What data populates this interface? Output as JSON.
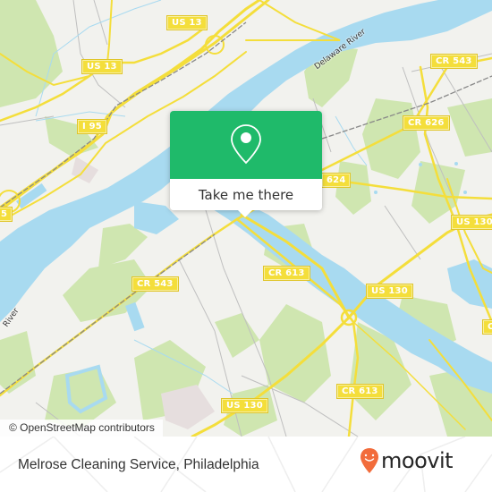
{
  "map": {
    "attribution": "© OpenStreetMap contributors",
    "colors": {
      "water": "#a8daf0",
      "land": "#f2f2ee",
      "park": "#cfe6b0",
      "road_major": "#f4de3b",
      "rail": "#888888",
      "accent_green": "#1fba6a"
    },
    "road_labels": [
      {
        "id": "us13-a",
        "text": "US 13"
      },
      {
        "id": "us13-b",
        "text": "US 13"
      },
      {
        "id": "i95",
        "text": "I 95"
      },
      {
        "id": "cr543-a",
        "text": "CR 543"
      },
      {
        "id": "cr626",
        "text": "CR 626"
      },
      {
        "id": "cr624",
        "text": "624"
      },
      {
        "id": "us130-a",
        "text": "US 130"
      },
      {
        "id": "us130-b",
        "text": "US 130"
      },
      {
        "id": "us130-c",
        "text": "US 130"
      },
      {
        "id": "cr543-b",
        "text": "CR 543"
      },
      {
        "id": "cr613-a",
        "text": "CR 613"
      },
      {
        "id": "cr613-b",
        "text": "CR 613"
      },
      {
        "id": "edge-left",
        "text": "5"
      },
      {
        "id": "edge-right",
        "text": "C"
      }
    ],
    "water_labels": [
      {
        "id": "delaware-river-1",
        "text": "Delaware River"
      },
      {
        "id": "delaware-river-2",
        "text": "River"
      }
    ]
  },
  "popup": {
    "icon": "map-pin-icon",
    "button_label": "Take me there"
  },
  "footer": {
    "place_title": "Melrose Cleaning Service, Philadelphia",
    "logo_text": "moovit",
    "logo_icon": "moovit-pin-icon",
    "logo_color": "#f26c3b"
  }
}
